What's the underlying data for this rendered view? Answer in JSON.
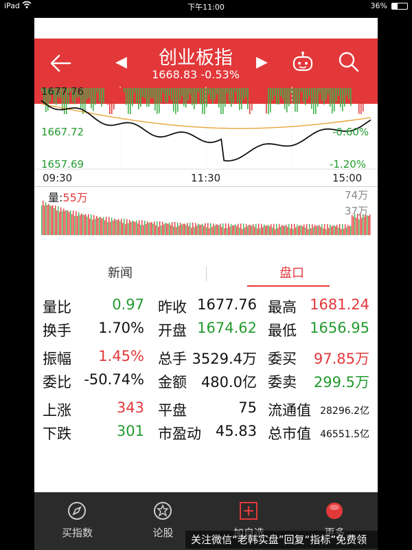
{
  "status_bar": {
    "device": "iPad",
    "time": "下午11:00",
    "battery": "36%",
    "battery_level": 0.36
  },
  "header": {
    "title": "创业板指",
    "quote": "1668.83 -0.53%",
    "colors": {
      "brand": "#e2383a"
    }
  },
  "intraday": {
    "y_high": "1677.76",
    "y_mid": "1667.72",
    "y_low": "1657.69",
    "pct_mid": "-0.60%",
    "pct_low": "-1.20%",
    "time_open": "09:30",
    "time_mid": "11:30",
    "time_close": "15:00"
  },
  "volume_chart": {
    "label_prefix": "量:",
    "label_value": "55万",
    "max": "74万",
    "half": "37万"
  },
  "tabs": {
    "news": "新闻",
    "pankou": "盘口"
  },
  "stats": {
    "rows": [
      {
        "l1": "量比",
        "v1": "0.97",
        "c1": "green",
        "l2": "昨收",
        "v2": "1677.76",
        "c2": "dark",
        "l3": "最高",
        "v3": "1681.24",
        "c3": "red"
      },
      {
        "l1": "换手",
        "v1": "1.70%",
        "c1": "dark",
        "l2": "开盘",
        "v2": "1674.62",
        "c2": "green",
        "l3": "最低",
        "v3": "1656.95",
        "c3": "green"
      },
      {
        "l1": "振幅",
        "v1": "1.45%",
        "c1": "red",
        "l2": "总手",
        "v2": "3529.4万",
        "c2": "dark",
        "l3": "委买",
        "v3": "97.85万",
        "c3": "red"
      },
      {
        "l1": "委比",
        "v1": "-50.74%",
        "c1": "dark",
        "l2": "金额",
        "v2": "480.0亿",
        "c2": "dark",
        "l3": "委卖",
        "v3": "299.5万",
        "c3": "green"
      },
      {
        "l1": "上涨",
        "v1": "343",
        "c1": "red",
        "l2": "平盘",
        "v2": "75",
        "c2": "dark",
        "l3": "流通值",
        "v3": "28296.2亿",
        "c3": "dark"
      },
      {
        "l1": "下跌",
        "v1": "301",
        "c1": "green",
        "l2": "市盈动",
        "v2": "45.83",
        "c2": "dark",
        "l3": "总市值",
        "v3": "46551.5亿",
        "c3": "dark"
      }
    ]
  },
  "bottom_nav": {
    "items": [
      {
        "label": "买指数",
        "icon": "compass-icon"
      },
      {
        "label": "论股",
        "icon": "chat-badge-icon"
      },
      {
        "label": "加自选",
        "icon": "add-box-icon"
      },
      {
        "label": "更多",
        "icon": "more-dot-icon"
      }
    ]
  },
  "promo": "关注微信“老韩实盘”回复“指标”免费领"
}
